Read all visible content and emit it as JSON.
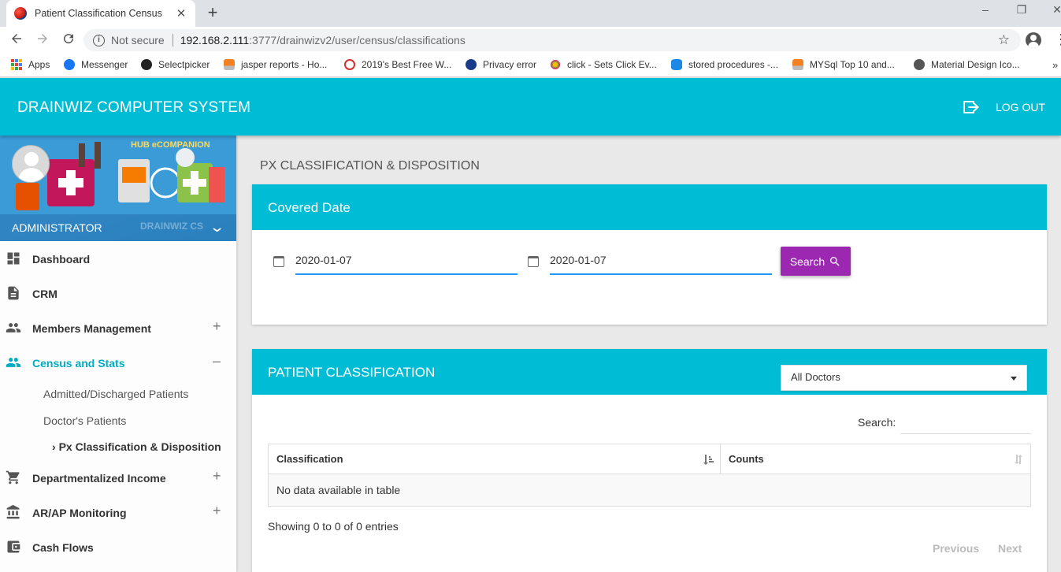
{
  "browser": {
    "tab_title": "Patient Classification Census",
    "tab_close": "✕",
    "new_tab": "+",
    "not_secure": "Not secure",
    "url_host": "192.168.2.111",
    "url_path": ":3777/drainwizv2/user/census/classifications",
    "window_controls": [
      "–",
      "❐",
      "✕"
    ],
    "bookmarks": [
      {
        "label": "Apps",
        "icon": "apps-grid-icon"
      },
      {
        "label": "Messenger",
        "icon": "messenger-icon",
        "color": "#1877f2"
      },
      {
        "label": "Selectpicker",
        "icon": "github-icon",
        "color": "#222222"
      },
      {
        "label": "jasper reports - Ho...",
        "icon": "stackoverflow-icon",
        "color": "#f48024"
      },
      {
        "label": "2019's Best Free W...",
        "icon": "site-icon",
        "color": "#d32f2f"
      },
      {
        "label": "Privacy error",
        "icon": "privacy-icon",
        "color": "#1a3a8a"
      },
      {
        "label": "click - Sets Click Ev...",
        "icon": "spark-icon",
        "color": "#e0b400"
      },
      {
        "label": "stored procedures -...",
        "icon": "database-icon",
        "color": "#1e88e5"
      },
      {
        "label": "MYSql Top 10 and...",
        "icon": "stackoverflow-icon",
        "color": "#f48024"
      },
      {
        "label": "Material Design Ico...",
        "icon": "globe-icon",
        "color": "#555555"
      }
    ],
    "bookmarks_more": "»"
  },
  "header": {
    "brand": "DRAINWIZ COMPUTER SYSTEM",
    "logout_label": "LOG OUT",
    "accent_color": "#00bcd4"
  },
  "sidebar": {
    "hub_label": "HUB eCOMPANION",
    "user_name": "ADMINISTRATOR",
    "watermark": "DRAINWIZ CS",
    "items": [
      {
        "label": "Dashboard",
        "icon": "dashboard-icon",
        "expand": ""
      },
      {
        "label": "CRM",
        "icon": "document-icon",
        "expand": ""
      },
      {
        "label": "Members Management",
        "icon": "people-icon",
        "expand": "+"
      },
      {
        "label": "Census and Stats",
        "icon": "people-icon",
        "expand": "–"
      },
      {
        "label": "Departmentalized Income",
        "icon": "cart-icon",
        "expand": "+"
      },
      {
        "label": "AR/AP Monitoring",
        "icon": "bank-icon",
        "expand": "+"
      },
      {
        "label": "Cash Flows",
        "icon": "wallet-icon",
        "expand": ""
      }
    ],
    "subitems": [
      {
        "label": "Admitted/Discharged Patients"
      },
      {
        "label": "Doctor's Patients"
      },
      {
        "label": "Px Classification & Disposition",
        "prefix": "›"
      }
    ]
  },
  "main": {
    "page_title": "PX CLASSIFICATION & DISPOSITION",
    "covered_date": {
      "title": "Covered Date",
      "date_from": "2020-01-07",
      "date_to": "2020-01-07",
      "search_button": "Search",
      "button_color": "#9c27b0"
    },
    "classification": {
      "title": "PATIENT CLASSIFICATION",
      "doctor_selected": "All Doctors",
      "search_label": "Search:",
      "search_value": "",
      "columns": [
        "Classification",
        "Counts"
      ],
      "empty_message": "No data available in table",
      "info": "Showing 0 to 0 of 0 entries",
      "prev": "Previous",
      "next": "Next"
    }
  }
}
